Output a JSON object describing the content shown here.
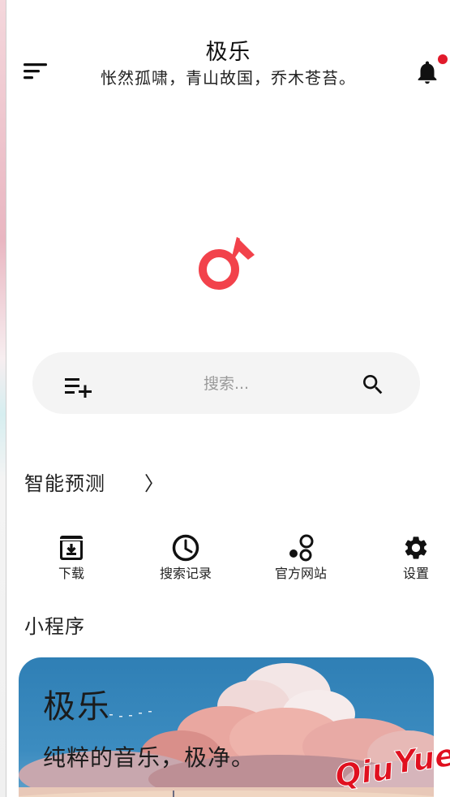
{
  "header": {
    "title": "极乐",
    "subtitle": "怅然孤啸，青山故国，乔木苍苔。",
    "menu_icon": "sort-menu-icon",
    "notification_icon": "bell-icon",
    "badge_color": "#e11a2b"
  },
  "logo": {
    "icon": "music-note-icon",
    "color": "#f2424b"
  },
  "search": {
    "placeholder": "搜索...",
    "value": "",
    "left_icon": "playlist-add-icon",
    "right_icon": "search-icon"
  },
  "prediction": {
    "label": "智能预测",
    "chevron": "〉"
  },
  "quick_actions": [
    {
      "label": "下载",
      "icon": "download-icon"
    },
    {
      "label": "搜索记录",
      "icon": "clock-icon"
    },
    {
      "label": "官方网站",
      "icon": "bubbles-icon"
    },
    {
      "label": "设置",
      "icon": "gear-icon"
    }
  ],
  "mini_programs": {
    "title": "小程序",
    "banner": {
      "title": "极乐",
      "subtitle": "纯粹的音乐，极净。",
      "watermark": "Qiu Yue",
      "watermark_color": "#e0101f"
    }
  }
}
